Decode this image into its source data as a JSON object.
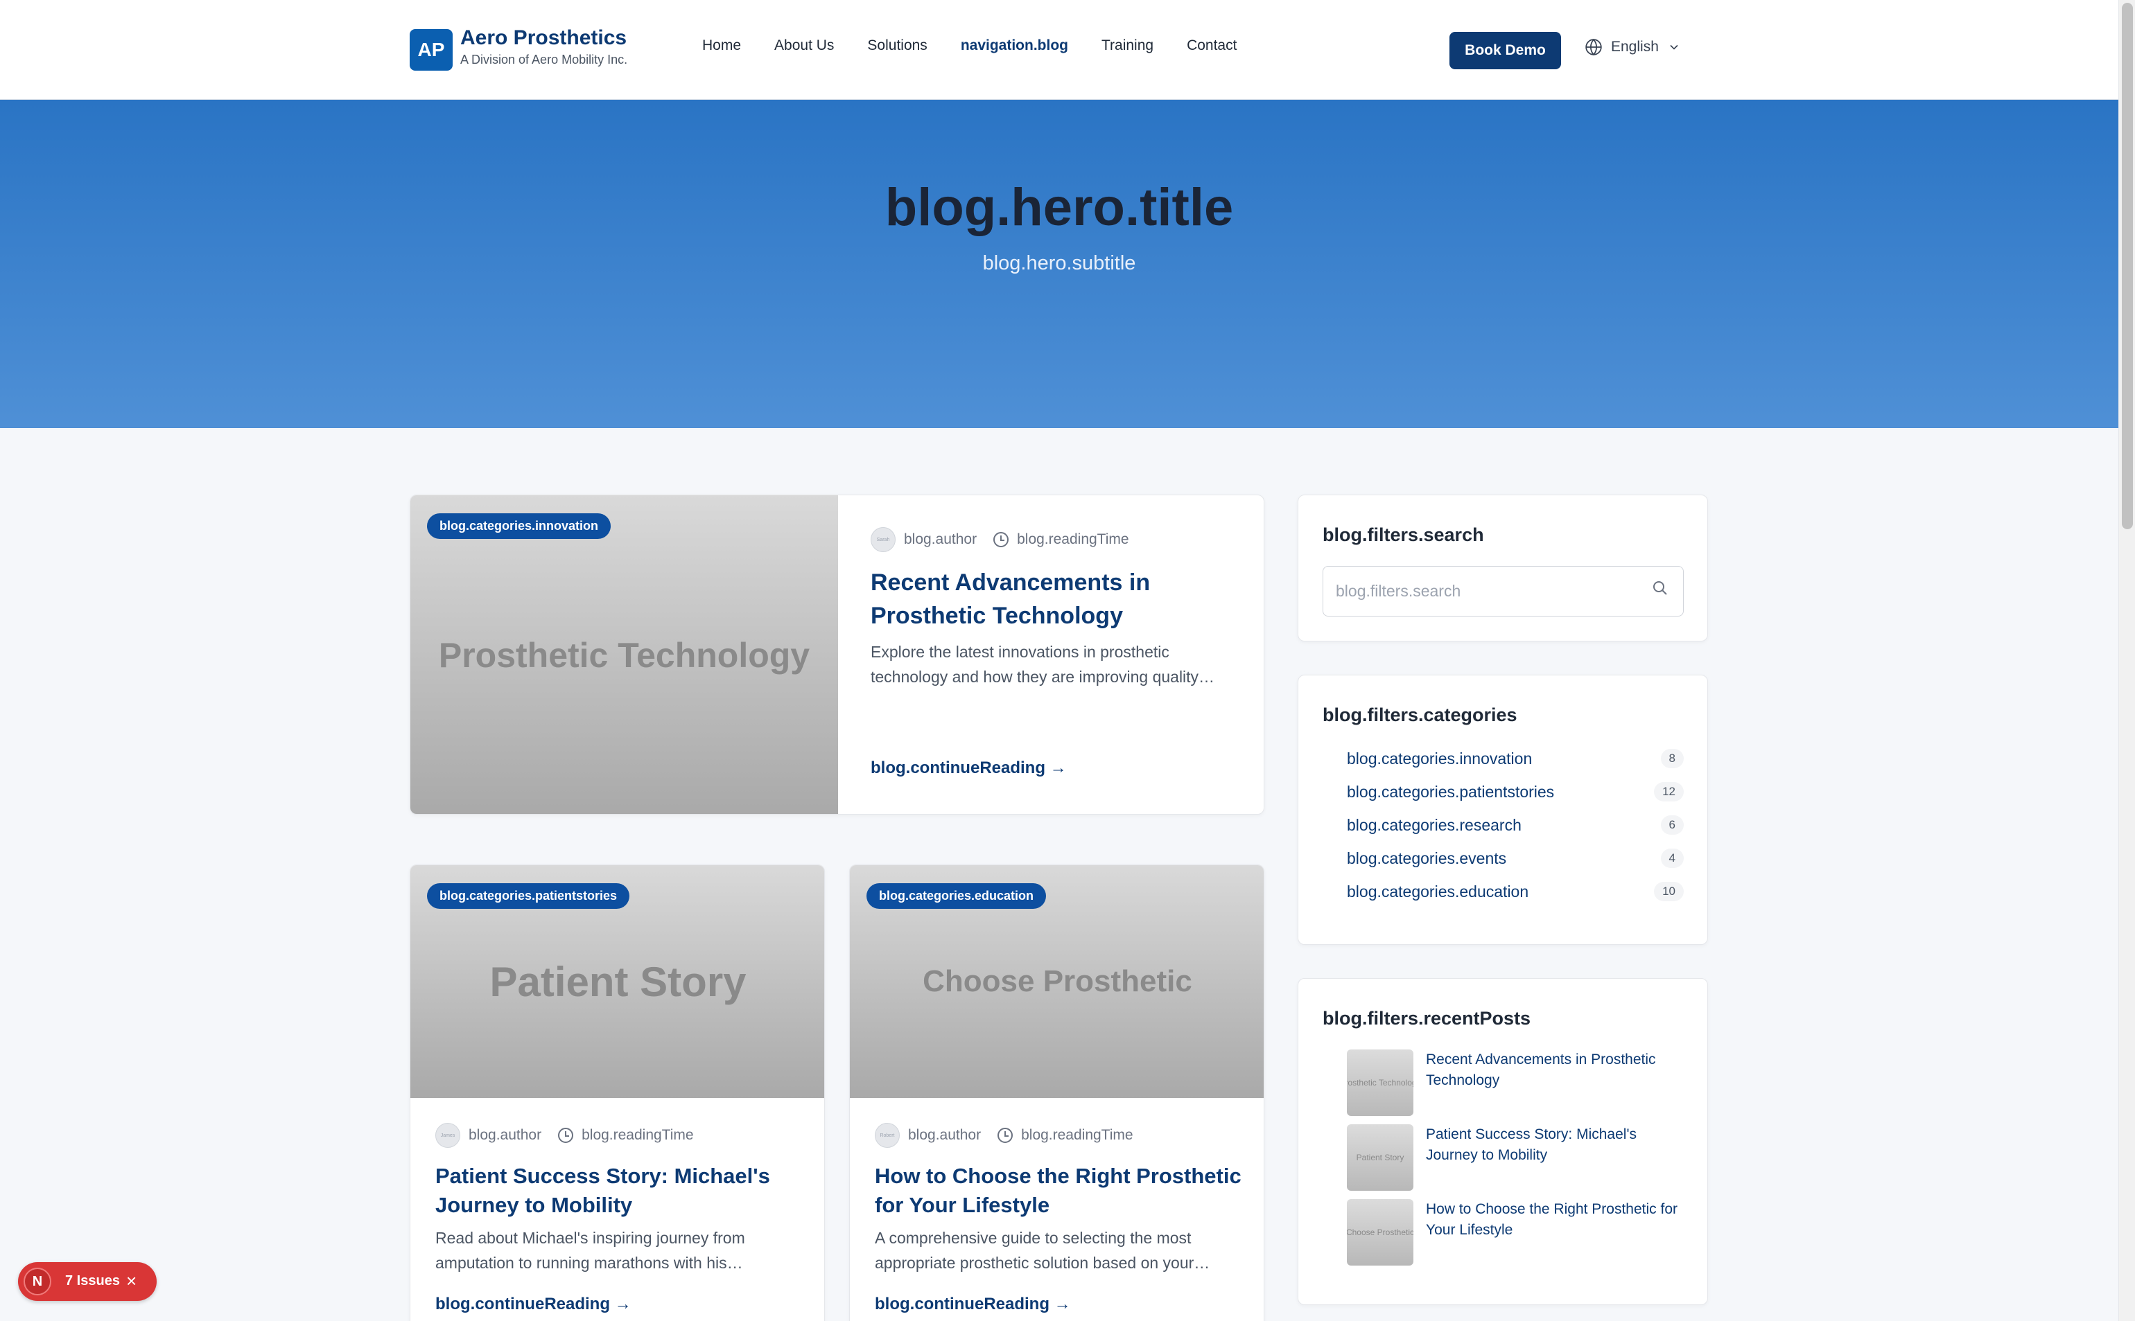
{
  "header": {
    "logo_initials": "AP",
    "brand_name": "Aero Prosthetics",
    "brand_sub": "A Division of Aero Mobility Inc.",
    "nav": [
      "Home",
      "About Us",
      "Solutions",
      "navigation.blog",
      "Training",
      "Contact"
    ],
    "active_nav": "navigation.blog",
    "cta": "Book Demo",
    "language": "English"
  },
  "hero": {
    "title": "blog.hero.title",
    "subtitle": "blog.hero.subtitle"
  },
  "featured": {
    "badge": "blog.categories.innovation",
    "image_text": "Prosthetic Technology",
    "author": "blog.author",
    "reading_time": "blog.readingTime",
    "title": "Recent Advancements in Prosthetic Technology",
    "excerpt": "Explore the latest innovations in prosthetic technology and how they are improving quality…",
    "link": "blog.continueReading"
  },
  "posts": [
    {
      "badge": "blog.categories.patientstories",
      "image_text": "Patient Story",
      "author": "blog.author",
      "reading_time": "blog.readingTime",
      "title": "Patient Success Story: Michael's Journey to Mobility",
      "excerpt": "Read about Michael's inspiring journey from amputation to running marathons with his…",
      "link": "blog.continueReading"
    },
    {
      "badge": "blog.categories.education",
      "image_text": "Choose Prosthetic",
      "author": "blog.author",
      "reading_time": "blog.readingTime",
      "title": "How to Choose the Right Prosthetic for Your Lifestyle",
      "excerpt": "A comprehensive guide to selecting the most appropriate prosthetic solution based on your…",
      "link": "blog.continueReading"
    }
  ],
  "sidebar": {
    "search_title": "blog.filters.search",
    "search_placeholder": "blog.filters.search",
    "categories_title": "blog.filters.categories",
    "categories": [
      {
        "label": "blog.categories.innovation",
        "count": "8"
      },
      {
        "label": "blog.categories.patientstories",
        "count": "12"
      },
      {
        "label": "blog.categories.research",
        "count": "6"
      },
      {
        "label": "blog.categories.events",
        "count": "4"
      },
      {
        "label": "blog.categories.education",
        "count": "10"
      }
    ],
    "recent_title": "blog.filters.recentPosts",
    "recent": [
      {
        "thumb_text": "Prosthetic Technology",
        "title": "Recent Advancements in Prosthetic Technology"
      },
      {
        "thumb_text": "Patient Story",
        "title": "Patient Success Story: Michael's Journey to Mobility"
      },
      {
        "thumb_text": "Choose Prosthetic",
        "title": "How to Choose the Right Prosthetic for Your Lifestyle"
      }
    ]
  },
  "issues_badge": {
    "logo": "N",
    "label": "7 Issues"
  },
  "colors": {
    "primary": "#0d3a73",
    "badge": "#0d4fa0",
    "hero_top": "#2a74c4",
    "hero_bottom": "#4f90d6",
    "issues": "#d93636"
  }
}
